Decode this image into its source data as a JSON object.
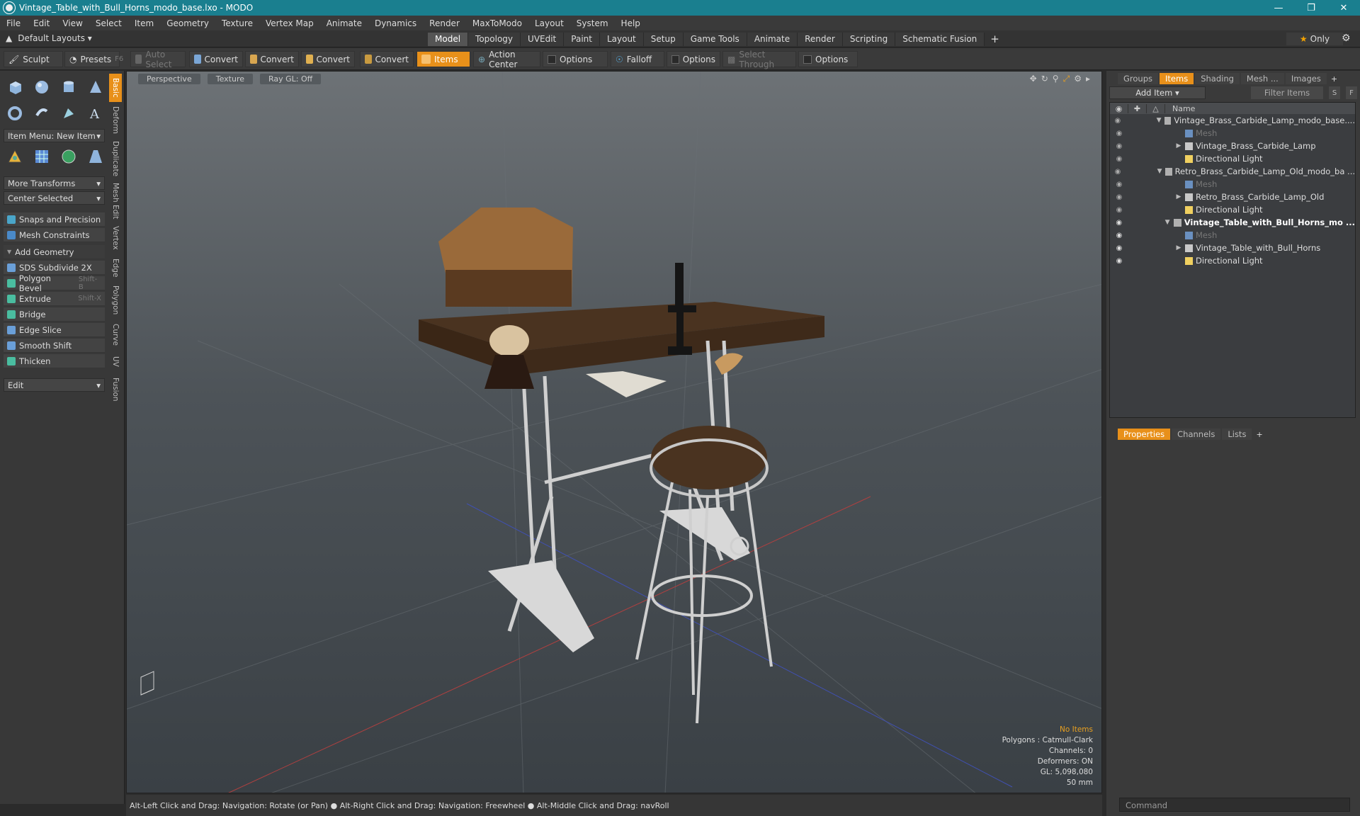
{
  "window": {
    "title": "Vintage_Table_with_Bull_Horns_modo_base.lxo - MODO"
  },
  "menu": [
    "File",
    "Edit",
    "View",
    "Select",
    "Item",
    "Geometry",
    "Texture",
    "Vertex Map",
    "Animate",
    "Dynamics",
    "Render",
    "MaxToModo",
    "Layout",
    "System",
    "Help"
  ],
  "layout": {
    "default_layouts": "Default Layouts",
    "tabs": [
      "Model",
      "Topology",
      "UVEdit",
      "Paint",
      "Layout",
      "Setup",
      "Game Tools",
      "Animate",
      "Render",
      "Scripting",
      "Schematic Fusion"
    ],
    "active_tab": "Model",
    "only_label": "Only"
  },
  "toolbar": {
    "sculpt": "Sculpt",
    "presets": "Presets",
    "presets_shortcut": "F6",
    "auto_select": "Auto Select",
    "convert": "Convert",
    "items": "Items",
    "action_center": "Action Center",
    "options": "Options",
    "falloff": "Falloff",
    "select_through": "Select Through"
  },
  "left": {
    "item_menu": "Item Menu: New Item",
    "more_transforms": "More Transforms",
    "center_selected": "Center Selected",
    "snaps": "Snaps and Precision",
    "mesh_constraints": "Mesh Constraints",
    "add_geometry": "Add Geometry",
    "tools": [
      {
        "label": "SDS Subdivide 2X",
        "shortcut": ""
      },
      {
        "label": "Polygon Bevel",
        "shortcut": "Shift-B"
      },
      {
        "label": "Extrude",
        "shortcut": "Shift-X"
      },
      {
        "label": "Bridge",
        "shortcut": ""
      },
      {
        "label": "Edge Slice",
        "shortcut": ""
      },
      {
        "label": "Smooth Shift",
        "shortcut": ""
      },
      {
        "label": "Thicken",
        "shortcut": ""
      }
    ],
    "edit": "Edit",
    "vtabs": [
      "Basic",
      "Deform",
      "Duplicate",
      "Mesh Edit",
      "Vertex",
      "Edge",
      "Polygon",
      "Curve",
      "UV",
      "Fusion"
    ]
  },
  "viewport": {
    "perspective": "Perspective",
    "texture": "Texture",
    "raygl": "Ray GL: Off",
    "stats": {
      "no_items": "No Items",
      "polygons": "Polygons : Catmull-Clark",
      "channels": "Channels: 0",
      "deformers": "Deformers: ON",
      "gl": "GL: 5,098,080",
      "focal": "50 mm"
    }
  },
  "status": "Alt-Left Click and Drag: Navigation: Rotate (or Pan) ● Alt-Right Click and Drag: Navigation: Freewheel ● Alt-Middle Click and Drag: navRoll",
  "right": {
    "top_tabs": [
      "Groups",
      "Items",
      "Shading",
      "Mesh ...",
      "Images"
    ],
    "active_top_tab": "Items",
    "add_item": "Add Item",
    "filter_items": "Filter Items",
    "s_btn": "S",
    "f_btn": "F",
    "col_name": "Name",
    "tree": [
      {
        "label": "Vintage_Brass_Carbide_Lamp_modo_base....",
        "indent": 0,
        "arrow": "▼",
        "type": "scene",
        "bold": false,
        "dim": false
      },
      {
        "label": "Mesh",
        "indent": 1,
        "arrow": "",
        "type": "mesh",
        "bold": false,
        "dim": true
      },
      {
        "label": "Vintage_Brass_Carbide_Lamp",
        "indent": 1,
        "arrow": "▶",
        "type": "group",
        "bold": false,
        "dim": false
      },
      {
        "label": "Directional Light",
        "indent": 1,
        "arrow": "",
        "type": "light",
        "bold": false,
        "dim": false
      },
      {
        "label": "Retro_Brass_Carbide_Lamp_Old_modo_ba ...",
        "indent": 0,
        "arrow": "▼",
        "type": "scene",
        "bold": false,
        "dim": false
      },
      {
        "label": "Mesh",
        "indent": 1,
        "arrow": "",
        "type": "mesh",
        "bold": false,
        "dim": true
      },
      {
        "label": "Retro_Brass_Carbide_Lamp_Old",
        "indent": 1,
        "arrow": "▶",
        "type": "group",
        "bold": false,
        "dim": false
      },
      {
        "label": "Directional Light",
        "indent": 1,
        "arrow": "",
        "type": "light",
        "bold": false,
        "dim": false
      },
      {
        "label": "Vintage_Table_with_Bull_Horns_mo ...",
        "indent": 0,
        "arrow": "▼",
        "type": "scene",
        "bold": true,
        "dim": false
      },
      {
        "label": "Mesh",
        "indent": 1,
        "arrow": "",
        "type": "mesh",
        "bold": false,
        "dim": true
      },
      {
        "label": "Vintage_Table_with_Bull_Horns",
        "indent": 1,
        "arrow": "▶",
        "type": "group",
        "bold": false,
        "dim": false
      },
      {
        "label": "Directional Light",
        "indent": 1,
        "arrow": "",
        "type": "light",
        "bold": false,
        "dim": false
      }
    ],
    "bottom_tabs": [
      "Properties",
      "Channels",
      "Lists"
    ],
    "active_bottom_tab": "Properties",
    "command_placeholder": "Command"
  },
  "colors": {
    "accent": "#e8901a",
    "title_bar": "#1a7f8f"
  }
}
